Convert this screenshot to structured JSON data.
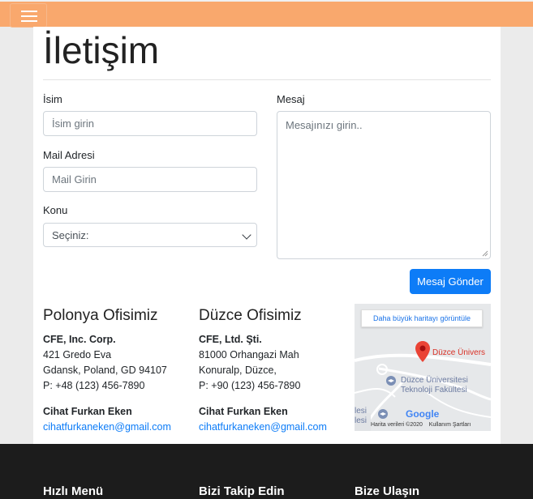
{
  "header": {
    "menu_icon": "hamburger-icon",
    "accent": "#f9a86d"
  },
  "page": {
    "title": "İletişim"
  },
  "form": {
    "name_label": "İsim",
    "name_placeholder": "İsim girin",
    "email_label": "Mail Adresi",
    "email_placeholder": "Mail Girin",
    "subject_label": "Konu",
    "subject_value": "Seçiniz:",
    "message_label": "Mesaj",
    "message_placeholder": "Mesajınızı girin..",
    "submit_label": "Mesaj Gönder",
    "submit_color": "#0d7cf7"
  },
  "offices": [
    {
      "title": "Polonya Ofisimiz",
      "company": "CFE, Inc. Corp.",
      "address1": "421 Gredo Eva",
      "address2": "Gdansk, Poland, GD 94107",
      "phone": "P: +48 (123) 456-7890",
      "contact_name": "Cihat Furkan Eken",
      "email": "cihatfurkaneken@gmail.com"
    },
    {
      "title": "Düzce Ofisimiz",
      "company": "CFE, Ltd. Şti.",
      "address1": "81000 Orhangazi Mah",
      "address2": "Konuralp, Düzce,",
      "phone": "P: +90 (123) 456-7890",
      "contact_name": "Cihat Furkan Eken",
      "email": "cihatfurkaneken@gmail.com"
    }
  ],
  "map": {
    "larger_map_label": "Daha büyük haritayı görüntüle",
    "pin_label": "Düzce Ünivers",
    "faculty_line1": "Düzce Üniversitesi",
    "faculty_line2": "Teknoloji Fakültesi",
    "left_label_line1": "lesi",
    "left_label_line2": "lesi",
    "google_logo": "Google",
    "footer_data": "Harita verileri ©2020",
    "footer_terms": "Kullanım Şartları"
  },
  "footer": {
    "quick_menu": "Hızlı Menü",
    "follow_us": "Bizi Takip Edin",
    "reach_us": "Bize Ulaşın"
  }
}
